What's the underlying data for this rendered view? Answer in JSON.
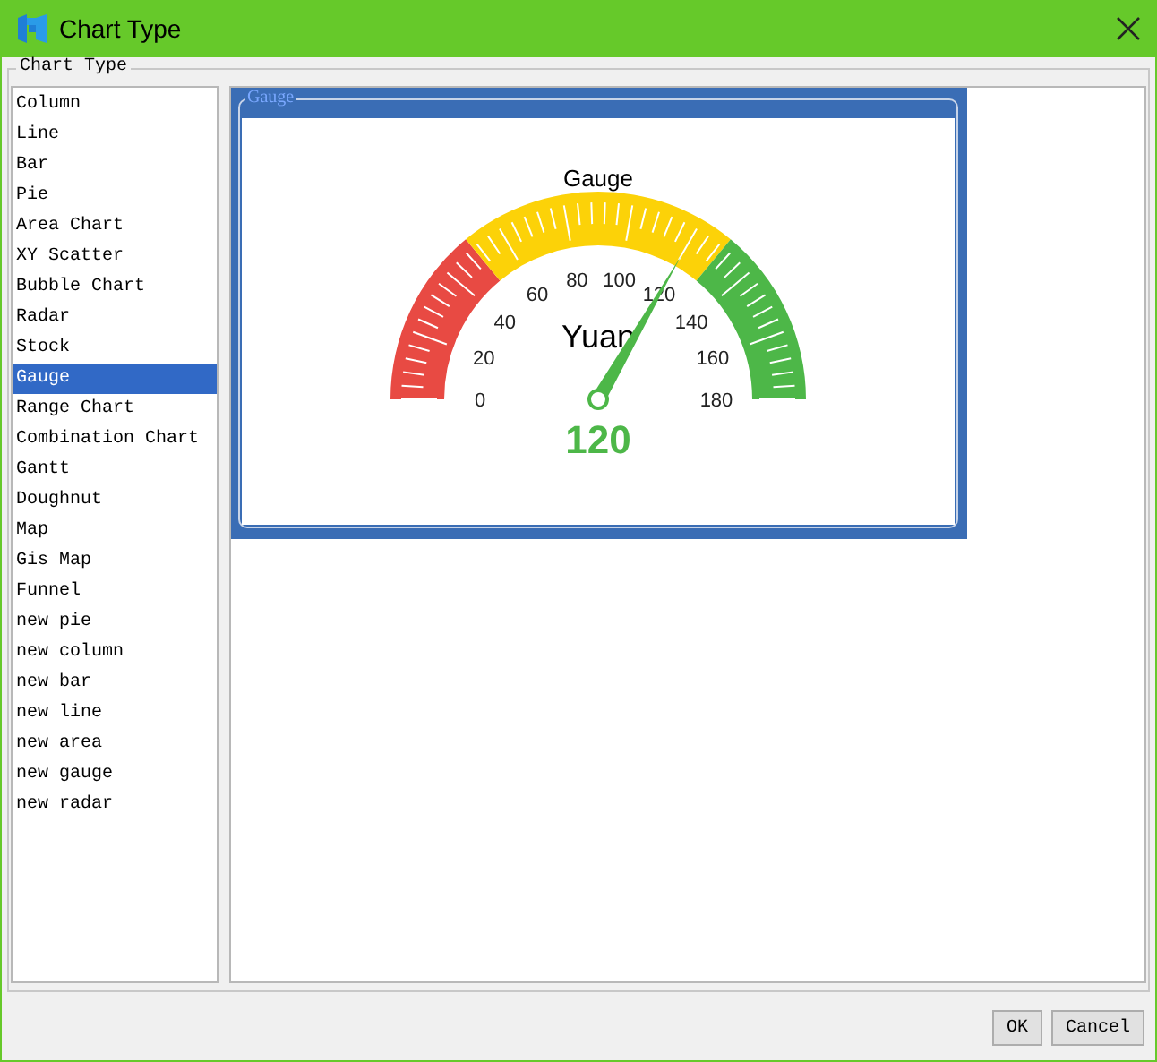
{
  "window": {
    "title": "Chart Type"
  },
  "group_label": "Chart Type",
  "chart_types": [
    {
      "label": "Column",
      "selected": false
    },
    {
      "label": "Line",
      "selected": false
    },
    {
      "label": "Bar",
      "selected": false
    },
    {
      "label": "Pie",
      "selected": false
    },
    {
      "label": "Area Chart",
      "selected": false
    },
    {
      "label": "XY Scatter",
      "selected": false
    },
    {
      "label": "Bubble Chart",
      "selected": false
    },
    {
      "label": "Radar",
      "selected": false
    },
    {
      "label": "Stock",
      "selected": false
    },
    {
      "label": "Gauge",
      "selected": true
    },
    {
      "label": "Range Chart",
      "selected": false
    },
    {
      "label": "Combination Chart",
      "selected": false
    },
    {
      "label": "Gantt",
      "selected": false
    },
    {
      "label": "Doughnut",
      "selected": false
    },
    {
      "label": "Map",
      "selected": false
    },
    {
      "label": "Gis Map",
      "selected": false
    },
    {
      "label": "Funnel",
      "selected": false
    },
    {
      "label": "new pie",
      "selected": false
    },
    {
      "label": "new column",
      "selected": false
    },
    {
      "label": "new bar",
      "selected": false
    },
    {
      "label": "new line",
      "selected": false
    },
    {
      "label": "new area",
      "selected": false
    },
    {
      "label": "new gauge",
      "selected": false
    },
    {
      "label": "new radar",
      "selected": false
    }
  ],
  "preview": {
    "label": "Gauge",
    "gauge": {
      "title": "Gauge",
      "unit": "Yuan",
      "value": "120",
      "scale": [
        "0",
        "20",
        "40",
        "60",
        "80",
        "100",
        "120",
        "140",
        "160",
        "180"
      ]
    }
  },
  "buttons": [
    "OK",
    "Cancel"
  ]
}
